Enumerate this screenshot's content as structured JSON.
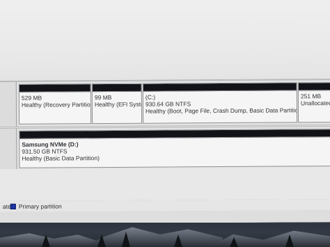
{
  "disk_top": {
    "partitions": [
      {
        "size": "529 MB",
        "status": "Healthy (Recovery Partition"
      },
      {
        "size": "99 MB",
        "status": "Healthy (EFI Systen"
      },
      {
        "letter": "(C:)",
        "size": "930.64 GB NTFS",
        "status": "Healthy (Boot, Page File, Crash Dump, Basic Data Partition)"
      },
      {
        "size": "251 MB",
        "status": "Unallocated"
      }
    ]
  },
  "disk_second": {
    "partitions": [
      {
        "name": "Samsung NVMe  (D:)",
        "size": "931.50 GB NTFS",
        "status": "Healthy (Basic Data Partition)"
      }
    ]
  },
  "legend": {
    "unallocated_suffix": "ated",
    "primary_partition": "Primary partition",
    "primary_color": "#1f35a5"
  },
  "colors": {
    "partition_bar": "#111318",
    "background": "#e9e9ea"
  }
}
